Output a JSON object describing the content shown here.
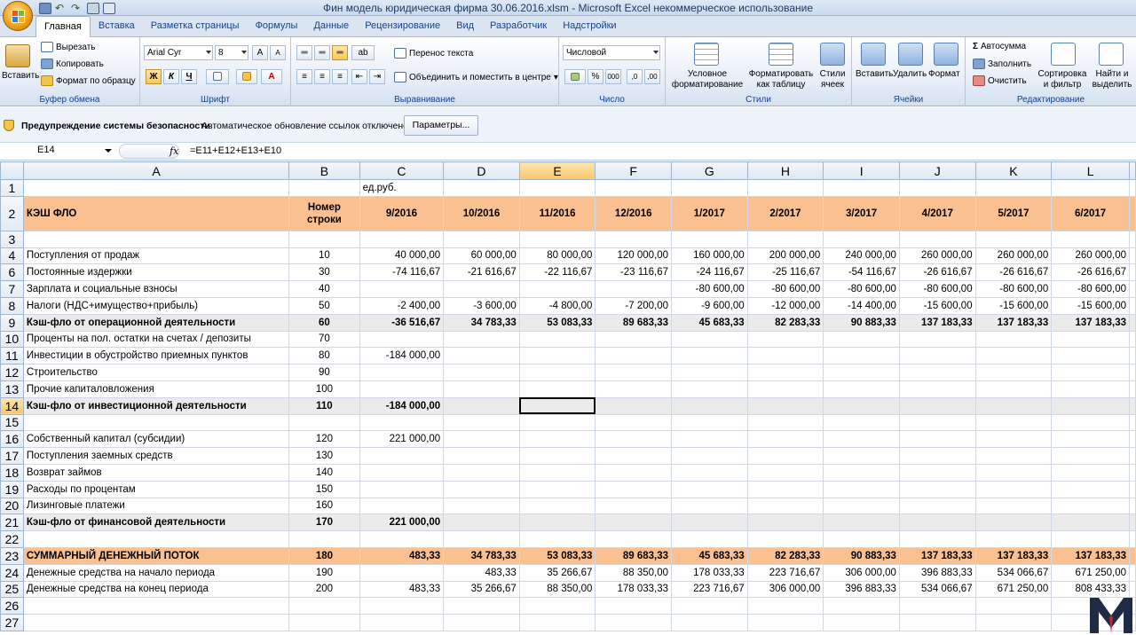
{
  "app": {
    "window_title": "Фин модель юридическая фирма 30.06.2016.xlsm - Microsoft Excel некоммерческое использование"
  },
  "ribbon_tabs": [
    "Главная",
    "Вставка",
    "Разметка страницы",
    "Формулы",
    "Данные",
    "Рецензирование",
    "Вид",
    "Разработчик",
    "Надстройки"
  ],
  "ribbon": {
    "clipboard": {
      "paste": "Вставить",
      "cut": "Вырезать",
      "copy": "Копировать",
      "format_painter": "Формат по образцу",
      "label": "Буфер обмена"
    },
    "font": {
      "name": "Arial Cyr",
      "size": "8",
      "bold": "Ж",
      "italic": "К",
      "underline": "Ч",
      "label": "Шрифт"
    },
    "alignment": {
      "wrap": "Перенос текста",
      "merge": "Объединить и поместить в центре",
      "label": "Выравнивание"
    },
    "number": {
      "format": "Числовой",
      "percent": "%",
      "thousands": "000",
      "label": "Число"
    },
    "styles": {
      "conditional": "Условное форматирование",
      "as_table": "Форматировать как таблицу",
      "cell_styles": "Стили ячеек",
      "label": "Стили"
    },
    "cells": {
      "insert": "Вставить",
      "delete": "Удалить",
      "format": "Формат",
      "label": "Ячейки"
    },
    "editing": {
      "autosum": "Автосумма",
      "fill": "Заполнить",
      "clear": "Очистить",
      "sort": "Сортировка и фильтр",
      "find": "Найти и выделить",
      "label": "Редактирование"
    }
  },
  "security_bar": {
    "title": "Предупреждение системы безопасности",
    "message": "Автоматическое обновление ссылок отключено",
    "button": "Параметры..."
  },
  "formula_bar": {
    "name_box": "E14",
    "fx": "fx",
    "formula": "=E11+E12+E13+E10"
  },
  "sheet": {
    "columns": [
      "A",
      "B",
      "C",
      "D",
      "E",
      "F",
      "G",
      "H",
      "I",
      "J",
      "K",
      "L"
    ],
    "selected_column": "E",
    "selected_row": "14",
    "rows": [
      {
        "n": "1",
        "type": "plain",
        "cells": [
          "",
          "",
          "ед.руб.",
          "",
          "",
          "",
          "",
          "",
          "",
          "",
          "",
          ""
        ]
      },
      {
        "n": "2",
        "type": "hdr",
        "cells": [
          "КЭШ ФЛО",
          "Номер строки",
          "9/2016",
          "10/2016",
          "11/2016",
          "12/2016",
          "1/2017",
          "2/2017",
          "3/2017",
          "4/2017",
          "5/2017",
          "6/2017"
        ]
      },
      {
        "n": "3",
        "type": "plain",
        "cells": [
          "",
          "",
          "",
          "",
          "",
          "",
          "",
          "",
          "",
          "",
          "",
          ""
        ]
      },
      {
        "n": "4",
        "type": "plain",
        "cells": [
          "Поступления от продаж",
          "10",
          "40 000,00",
          "60 000,00",
          "80 000,00",
          "120 000,00",
          "160 000,00",
          "200 000,00",
          "240 000,00",
          "260 000,00",
          "260 000,00",
          "260 000,00"
        ]
      },
      {
        "n": "6",
        "type": "plain",
        "cells": [
          "Постоянные издержки",
          "30",
          "-74 116,67",
          "-21 616,67",
          "-22 116,67",
          "-23 116,67",
          "-24 116,67",
          "-25 116,67",
          "-54 116,67",
          "-26 616,67",
          "-26 616,67",
          "-26 616,67"
        ]
      },
      {
        "n": "7",
        "type": "plain",
        "cells": [
          "Зарплата и социальные взносы",
          "40",
          "",
          "",
          "",
          "",
          "-80 600,00",
          "-80 600,00",
          "-80 600,00",
          "-80 600,00",
          "-80 600,00",
          "-80 600,00"
        ]
      },
      {
        "n": "8",
        "type": "plain",
        "cells": [
          "Налоги (НДС+имущество+прибыль)",
          "50",
          "-2 400,00",
          "-3 600,00",
          "-4 800,00",
          "-7 200,00",
          "-9 600,00",
          "-12 000,00",
          "-14 400,00",
          "-15 600,00",
          "-15 600,00",
          "-15 600,00"
        ]
      },
      {
        "n": "9",
        "type": "total",
        "cells": [
          "Кэш-фло от операционной деятельности",
          "60",
          "-36 516,67",
          "34 783,33",
          "53 083,33",
          "89 683,33",
          "45 683,33",
          "82 283,33",
          "90 883,33",
          "137 183,33",
          "137 183,33",
          "137 183,33"
        ]
      },
      {
        "n": "10",
        "type": "plain",
        "cells": [
          "Проценты на пол. остатки на счетах / депозиты",
          "70",
          "",
          "",
          "",
          "",
          "",
          "",
          "",
          "",
          "",
          ""
        ]
      },
      {
        "n": "11",
        "type": "plain",
        "cells": [
          "Инвестиции в обустройство приемных пунктов",
          "80",
          "-184 000,00",
          "",
          "",
          "",
          "",
          "",
          "",
          "",
          "",
          ""
        ]
      },
      {
        "n": "12",
        "type": "plain",
        "cells": [
          "Строительство",
          "90",
          "",
          "",
          "",
          "",
          "",
          "",
          "",
          "",
          "",
          ""
        ]
      },
      {
        "n": "13",
        "type": "plain",
        "cells": [
          "Прочие капиталовложения",
          "100",
          "",
          "",
          "",
          "",
          "",
          "",
          "",
          "",
          "",
          ""
        ]
      },
      {
        "n": "14",
        "type": "total",
        "cells": [
          "Кэш-фло от инвестиционной деятельности",
          "110",
          "-184 000,00",
          "",
          "",
          "",
          "",
          "",
          "",
          "",
          "",
          ""
        ]
      },
      {
        "n": "15",
        "type": "plain",
        "cells": [
          "",
          "",
          "",
          "",
          "",
          "",
          "",
          "",
          "",
          "",
          "",
          ""
        ]
      },
      {
        "n": "16",
        "type": "plain",
        "cells": [
          "Собственный капитал (субсидии)",
          "120",
          "221 000,00",
          "",
          "",
          "",
          "",
          "",
          "",
          "",
          "",
          ""
        ]
      },
      {
        "n": "17",
        "type": "plain",
        "cells": [
          "Поступления заемных средств",
          "130",
          "",
          "",
          "",
          "",
          "",
          "",
          "",
          "",
          "",
          ""
        ]
      },
      {
        "n": "18",
        "type": "plain",
        "cells": [
          "Возврат займов",
          "140",
          "",
          "",
          "",
          "",
          "",
          "",
          "",
          "",
          "",
          ""
        ]
      },
      {
        "n": "19",
        "type": "plain",
        "cells": [
          "Расходы по процентам",
          "150",
          "",
          "",
          "",
          "",
          "",
          "",
          "",
          "",
          "",
          ""
        ]
      },
      {
        "n": "20",
        "type": "plain",
        "cells": [
          "Лизинговые платежи",
          "160",
          "",
          "",
          "",
          "",
          "",
          "",
          "",
          "",
          "",
          ""
        ]
      },
      {
        "n": "21",
        "type": "total",
        "cells": [
          "Кэш-фло от финансовой деятельности",
          "170",
          "221 000,00",
          "",
          "",
          "",
          "",
          "",
          "",
          "",
          "",
          ""
        ]
      },
      {
        "n": "22",
        "type": "plain",
        "cells": [
          "",
          "",
          "",
          "",
          "",
          "",
          "",
          "",
          "",
          "",
          "",
          ""
        ]
      },
      {
        "n": "23",
        "type": "grand",
        "cells": [
          "СУММАРНЫЙ ДЕНЕЖНЫЙ ПОТОК",
          "180",
          "483,33",
          "34 783,33",
          "53 083,33",
          "89 683,33",
          "45 683,33",
          "82 283,33",
          "90 883,33",
          "137 183,33",
          "137 183,33",
          "137 183,33"
        ]
      },
      {
        "n": "24",
        "type": "plain",
        "cells": [
          "Денежные средства на начало периода",
          "190",
          "",
          "483,33",
          "35 266,67",
          "88 350,00",
          "178 033,33",
          "223 716,67",
          "306 000,00",
          "396 883,33",
          "534 066,67",
          "671 250,00"
        ]
      },
      {
        "n": "25",
        "type": "plain",
        "cells": [
          "Денежные средства на конец периода",
          "200",
          "483,33",
          "35 266,67",
          "88 350,00",
          "178 033,33",
          "223 716,67",
          "306 000,00",
          "396 883,33",
          "534 066,67",
          "671 250,00",
          "808 433,33"
        ]
      },
      {
        "n": "26",
        "type": "plain",
        "cells": [
          "",
          "",
          "",
          "",
          "",
          "",
          "",
          "",
          "",
          "",
          "",
          ""
        ]
      },
      {
        "n": "27",
        "type": "plain",
        "cells": [
          "",
          "",
          "",
          "",
          "",
          "",
          "",
          "",
          "",
          "",
          "",
          ""
        ]
      }
    ]
  },
  "colors": {
    "header_fill": "#fac090",
    "total_fill": "#ebebeb",
    "selection": "#f7c76a",
    "logo": "#1f2a44",
    "logo_accent": "#c62828"
  }
}
